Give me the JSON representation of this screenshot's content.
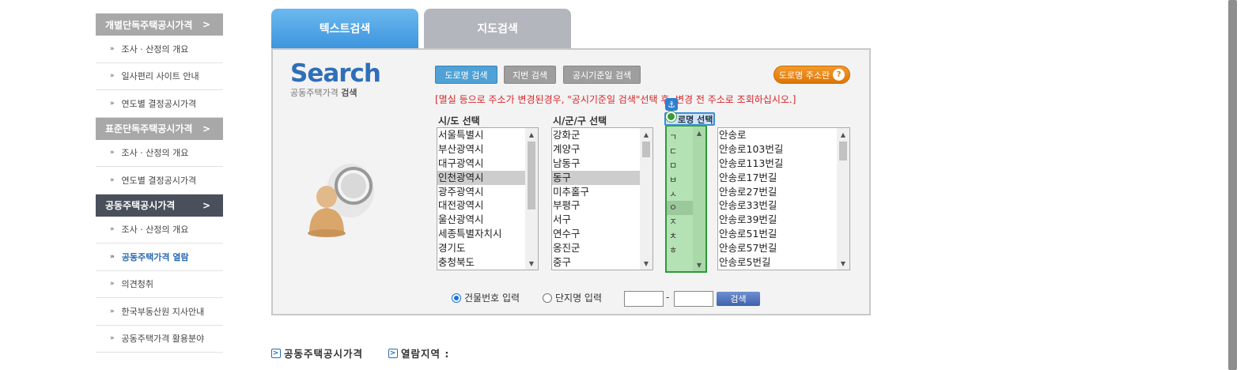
{
  "sidebar": {
    "sections": [
      {
        "title": "개별단독주택공시가격",
        "arrow": ">",
        "dark": false,
        "items": [
          "조사 · 산정의 개요",
          "일사편리 사이트 안내",
          "연도별 결정공시가격"
        ]
      },
      {
        "title": "표준단독주택공시가격",
        "arrow": ">",
        "dark": false,
        "items": [
          "조사 · 산정의 개요",
          "연도별 결정공시가격"
        ]
      },
      {
        "title": "공동주택공시가격",
        "arrow": ">",
        "dark": true,
        "items": [
          "조사 · 산정의 개요",
          "공동주택가격 열람",
          "의견청취",
          "한국부동산원 지사안내",
          "공동주택가격 활용분야"
        ],
        "active_index": 1
      }
    ],
    "bullet": "»"
  },
  "tabs": {
    "text_search": "텍스트검색",
    "map_search": "지도검색"
  },
  "logo": {
    "title": "Search",
    "subtitle_plain": "공동주택가격",
    "subtitle_bold": "검색"
  },
  "buttons": {
    "road_search": "도로명 검색",
    "lot_search": "지번 검색",
    "date_search": "공시기준일 검색",
    "road_info": "도로명 주소란",
    "road_info_icon": "?"
  },
  "notice": "[멸실 등으로 주소가 변경된경우, \"공시기준일 검색\"선택 후, 변경 전 주소로 조회하십시오.]",
  "labels": {
    "sido": "시/도 선택",
    "sigungu": "시/군/구 선택",
    "road": "로명 선택"
  },
  "lists": {
    "sido": {
      "items": [
        "서울특별시",
        "부산광역시",
        "대구광역시",
        "인천광역시",
        "광주광역시",
        "대전광역시",
        "울산광역시",
        "세종특별자치시",
        "경기도",
        "충청북도"
      ],
      "selected": 3
    },
    "sigungu": {
      "items": [
        "강화군",
        "계양구",
        "남동구",
        "동구",
        "미추홀구",
        "부평구",
        "서구",
        "연수구",
        "옹진군",
        "중구"
      ],
      "selected": 3
    },
    "chosung": {
      "items": [
        "ㄱ",
        "ㄷ",
        "ㅁ",
        "ㅂ",
        "ㅅ",
        "ㅇ",
        "ㅈ",
        "ㅊ",
        "ㅎ"
      ],
      "selected": 5
    },
    "road": {
      "items": [
        "안송로",
        "안송로103번길",
        "안송로113번길",
        "안송로17번길",
        "안송로27번길",
        "안송로33번길",
        "안송로39번길",
        "안송로51번길",
        "안송로57번길",
        "안송로5번길"
      ],
      "selected": -1
    }
  },
  "radios": {
    "building_no": "건물번호 입력",
    "complex_name": "단지명 입력",
    "selected": "building_no"
  },
  "inputs": {
    "dash": "-",
    "search_button": "검색"
  },
  "bottom": {
    "link1": "공동주택공시가격",
    "link2": "열람지역 :"
  },
  "icons": {
    "anchor": "⚓",
    "scroll_up": "▲",
    "scroll_down": "▼",
    "arrow_box": ">"
  },
  "colors": {
    "accent": "#3d95dd",
    "notice": "#d6262b",
    "chosung_bg": "#b5e2b5",
    "road_info": "#e07606"
  }
}
